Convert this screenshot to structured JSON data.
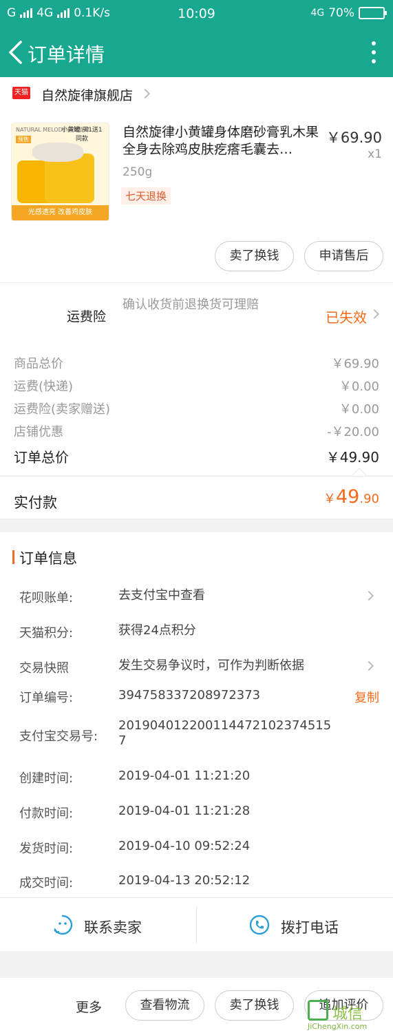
{
  "status": {
    "carrier_left": "G",
    "network": "4G",
    "speed": "0.1K/s",
    "time": "10:09",
    "network_right": "4G",
    "battery": "70%",
    "battery_level": 0.7
  },
  "header": {
    "title": "订单详情"
  },
  "store": {
    "badge": "天猫",
    "name": "自然旋律旗舰店"
  },
  "product": {
    "title": "自然旋律小黄罐身体磨砂膏乳木果全身去除鸡皮肤疙瘩毛囊去…",
    "price": "￥69.90",
    "qty": "x1",
    "spec": "250g",
    "tag": "七天退换",
    "image": {
      "brand": "NATURAL MELODY 自然旋律",
      "flag": "预售",
      "promo": "小黄罐 买1送1同款",
      "band": "光感透亮 改善鸡皮肤"
    },
    "buttons": [
      "卖了换钱",
      "申请售后"
    ]
  },
  "insurance": {
    "label": "运费险",
    "desc": "确认收货前退换货可理赔",
    "status": "已失效"
  },
  "summary": {
    "rows": [
      {
        "label": "商品总价",
        "value": "￥69.90"
      },
      {
        "label": "运费(快递)",
        "value": "￥0.00"
      },
      {
        "label": "运费险(卖家赠送)",
        "value": "￥0.00"
      },
      {
        "label": "店铺优惠",
        "value": "-￥20.00"
      }
    ],
    "total_label": "订单总价",
    "total_value": "￥49.90"
  },
  "paid": {
    "label": "实付款",
    "symbol": "￥",
    "amount_int": "49",
    "amount_dec": ".90"
  },
  "order_info": {
    "heading": "订单信息",
    "rows": [
      {
        "label": "花呗账单:",
        "value": "去支付宝中查看"
      },
      {
        "label": "天猫积分:",
        "value": "获得24点积分"
      },
      {
        "label": "交易快照",
        "value": "发生交易争议时，可作为判断依据"
      },
      {
        "label": "订单编号:",
        "value": "394758337208972373",
        "action": "复制"
      },
      {
        "label": "支付宝交易号:",
        "value": "201904012200114472102374515 7"
      },
      {
        "label": "创建时间:",
        "value": "2019-04-01 11:21:20"
      },
      {
        "label": "付款时间:",
        "value": "2019-04-01 11:21:28"
      },
      {
        "label": "发货时间:",
        "value": "2019-04-10 09:52:24"
      },
      {
        "label": "成交时间:",
        "value": "2019-04-13 20:52:12"
      }
    ]
  },
  "contact": {
    "seller": "联系卖家",
    "call": "拨打电话"
  },
  "footer": {
    "more": "更多",
    "buttons": [
      "查看物流",
      "卖了换钱",
      "追加评价"
    ]
  },
  "watermark": {
    "name": "城信",
    "url": "JiChengXin.com"
  },
  "colors": {
    "brand": "#17a88f",
    "accent": "#f56a1b",
    "link": "#2a9fd8"
  }
}
